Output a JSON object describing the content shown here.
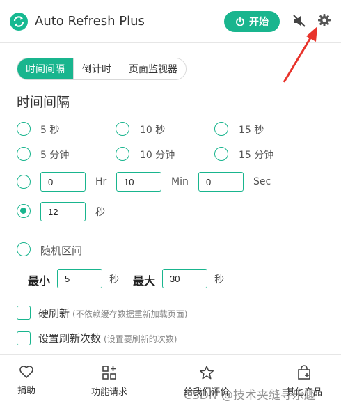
{
  "header": {
    "title": "Auto Refresh Plus",
    "start_label": "开始",
    "accent": "#19b58e"
  },
  "tabs": [
    {
      "label": "时间间隔",
      "active": true
    },
    {
      "label": "倒计时",
      "active": false
    },
    {
      "label": "页面监视器",
      "active": false
    }
  ],
  "section_title": "时间间隔",
  "presets": {
    "row1": [
      "5 秒",
      "10 秒",
      "15 秒"
    ],
    "row2": [
      "5 分钟",
      "10 分钟",
      "15 分钟"
    ]
  },
  "custom_time": {
    "hr_value": "0",
    "hr_label": "Hr",
    "min_value": "10",
    "min_label": "Min",
    "sec_value": "0",
    "sec_label": "Sec"
  },
  "seconds_option": {
    "value": "12",
    "unit": "秒",
    "selected": true
  },
  "random_range": {
    "label": "随机区间",
    "min_label": "最小",
    "min_value": "5",
    "min_unit": "秒",
    "max_label": "最大",
    "max_value": "30",
    "max_unit": "秒"
  },
  "options": {
    "hard_refresh_label": "硬刷新",
    "hard_refresh_hint": "(不依赖缓存数据重新加载页面)",
    "refresh_count_label": "设置刷新次数",
    "refresh_count_hint": "(设置要刷新的次数)"
  },
  "footer": {
    "items": [
      {
        "label": "捐助",
        "icon": "heart-icon"
      },
      {
        "label": "功能请求",
        "icon": "apps-add-icon"
      },
      {
        "label": "给我们评价",
        "icon": "star-icon"
      },
      {
        "label": "其他产品",
        "icon": "shopping-bag-icon"
      }
    ],
    "watermark": "CSDN @技术夹缝寻乐趣"
  }
}
